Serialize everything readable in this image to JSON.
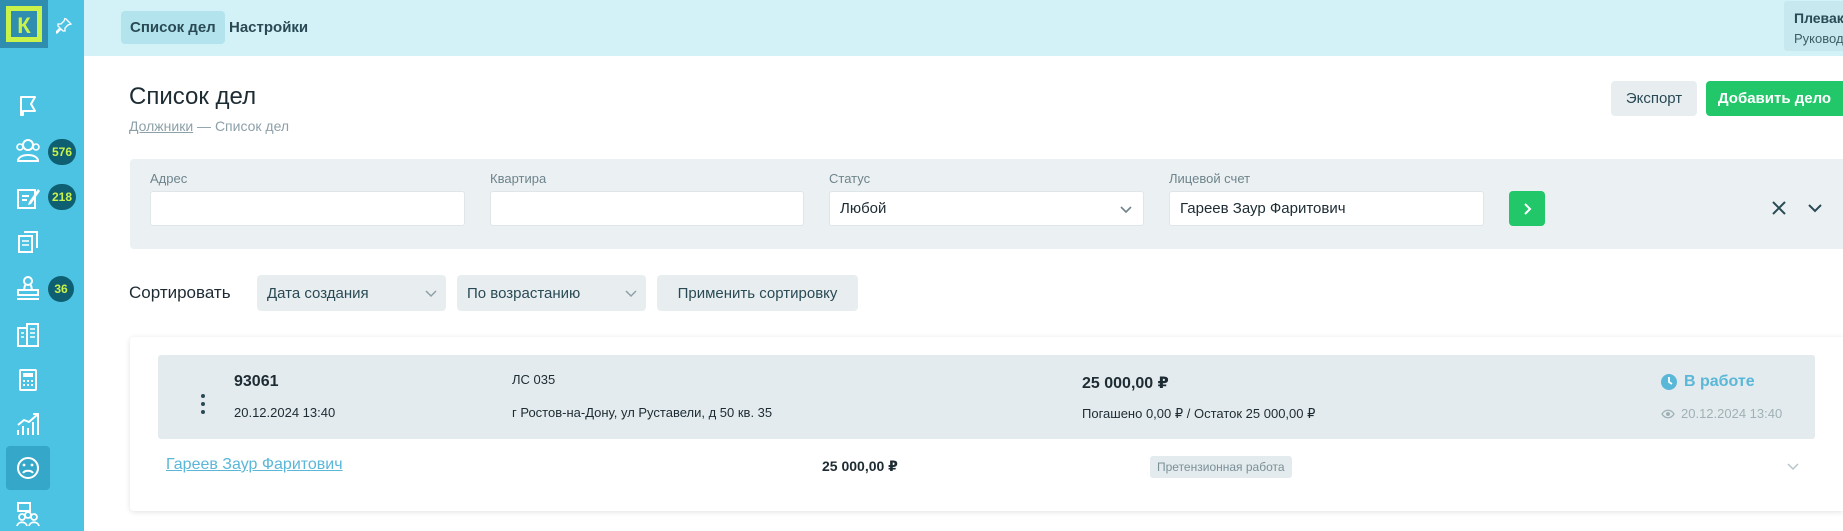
{
  "app": {
    "logo_letter": "К",
    "colors": {
      "sidebar": "#4cc3e3",
      "accent_green": "#22c76a",
      "link_blue": "#5ab7d8",
      "badge_text": "#c9f24a"
    }
  },
  "sidebar": {
    "items": [
      {
        "icon": "flag-icon",
        "badge": ""
      },
      {
        "icon": "users-icon",
        "badge": "576"
      },
      {
        "icon": "edit-document-icon",
        "badge": "218"
      },
      {
        "icon": "documents-icon",
        "badge": ""
      },
      {
        "icon": "court-stamp-icon",
        "badge": "36"
      },
      {
        "icon": "building-icon",
        "badge": ""
      },
      {
        "icon": "calculator-icon",
        "badge": ""
      },
      {
        "icon": "analytics-icon",
        "badge": ""
      },
      {
        "icon": "sad-face-icon",
        "badge": "",
        "active": true
      },
      {
        "icon": "team-icon",
        "badge": ""
      }
    ]
  },
  "topbar": {
    "tabs": [
      "Список дел",
      "Настройки"
    ],
    "user": {
      "name": "Плевако Д. В.",
      "role": "Руководитель, Клюкови"
    }
  },
  "header": {
    "title": "Список дел",
    "breadcrumb_parent": "Должники",
    "breadcrumb_separator": "—",
    "breadcrumb_current": "Список дел",
    "export_label": "Экспорт",
    "add_label": "Добавить дело"
  },
  "filters": {
    "address": {
      "label": "Адрес",
      "value": ""
    },
    "apartment": {
      "label": "Квартира",
      "value": ""
    },
    "status": {
      "label": "Статус",
      "value": "Любой"
    },
    "account": {
      "label": "Лицевой счет",
      "value": "Гареев Заур Фаритович"
    }
  },
  "sort": {
    "label": "Сортировать",
    "field": "Дата создания",
    "order": "По возрастанию",
    "apply_label": "Применить сортировку"
  },
  "cases": [
    {
      "number": "93061",
      "created": "20.12.2024 13:40",
      "account": "ЛС 035",
      "address": "г Ростов-на-Дону, ул Руставели, д 50 кв. 35",
      "sum": "25 000,00 ₽",
      "paid": "Погашено 0,00 ₽ / Остаток 25 000,00 ₽",
      "status": "В работе",
      "updated": "20.12.2024 13:40",
      "debtor": "Гареев Заур Фаритович",
      "debtor_sum": "25 000,00 ₽",
      "stage": "Претензионная работа"
    }
  ]
}
